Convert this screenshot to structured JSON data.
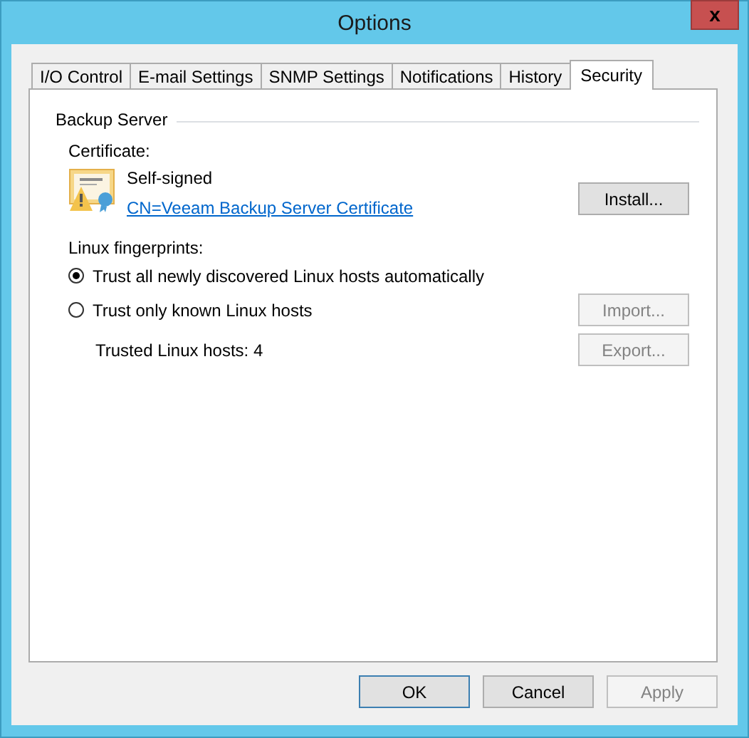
{
  "window": {
    "title": "Options",
    "close": "x"
  },
  "tabs": [
    {
      "label": "I/O Control",
      "selected": false
    },
    {
      "label": "E-mail Settings",
      "selected": false
    },
    {
      "label": "SNMP Settings",
      "selected": false
    },
    {
      "label": "Notifications",
      "selected": false
    },
    {
      "label": "History",
      "selected": false
    },
    {
      "label": "Security",
      "selected": true
    }
  ],
  "group": {
    "title": "Backup Server"
  },
  "certificate": {
    "label": "Certificate:",
    "status": "Self-signed",
    "link": "CN=Veeam Backup Server Certificate",
    "button": {
      "label": "Install...",
      "disabled": false
    }
  },
  "fingerprints": {
    "label": "Linux fingerprints:",
    "options": [
      {
        "label": "Trust all newly discovered Linux hosts automatically",
        "selected": true
      },
      {
        "label": "Trust only known Linux hosts",
        "selected": false,
        "button": {
          "label": "Import...",
          "disabled": true
        }
      }
    ],
    "trusted": "Trusted Linux hosts: 4",
    "button": {
      "label": "Export...",
      "disabled": true
    }
  },
  "buttons": [
    {
      "label": "OK",
      "default": true,
      "disabled": false
    },
    {
      "label": "Cancel",
      "default": false,
      "disabled": false
    },
    {
      "label": "Apply",
      "default": false,
      "disabled": true
    }
  ]
}
